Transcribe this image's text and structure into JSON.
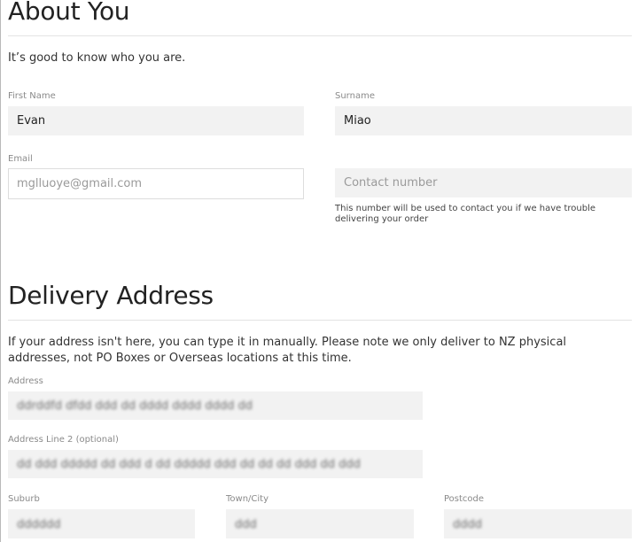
{
  "about": {
    "title": "About You",
    "subtitle": "It’s good to know who you are.",
    "first_name_label": "First Name",
    "first_name_value": "Evan",
    "surname_label": "Surname",
    "surname_value": "Miao",
    "email_label": "Email",
    "email_value": "mglluoye@gmail.com",
    "contact_placeholder": "Contact number",
    "contact_help": "This number will be used to contact you if we have trouble delivering your order"
  },
  "delivery": {
    "title": "Delivery Address",
    "note": "If your address isn't here, you can type it in manually. Please note we only deliver to NZ physical addresses, not PO Boxes or Overseas locations at this time.",
    "address_label": "Address",
    "address_value": "ddrddfd dfdd ddd dd dddd dddd dddd dd",
    "address2_label": "Address Line 2 (optional)",
    "address2_value": "dd ddd ddddd dd ddd d dd ddddd ddd dd dd dd ddd dd ddd",
    "suburb_label": "Suburb",
    "suburb_value": "dddddd",
    "town_label": "Town/City",
    "town_value": "ddd",
    "postcode_label": "Postcode",
    "postcode_value": "dddd"
  }
}
